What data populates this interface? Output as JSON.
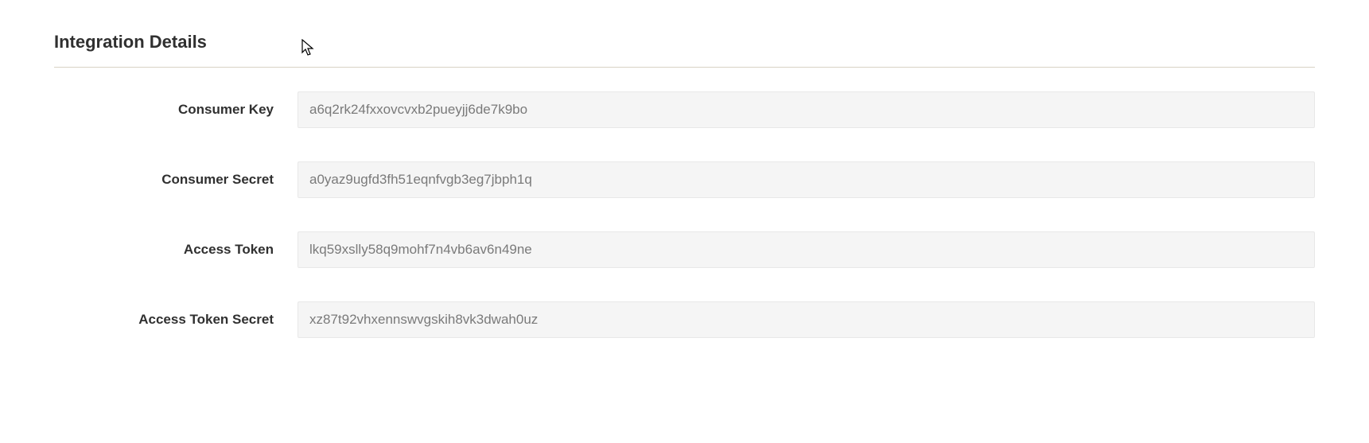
{
  "section": {
    "title": "Integration Details",
    "fields": [
      {
        "label": "Consumer Key",
        "value": "a6q2rk24fxxovcvxb2pueyjj6de7k9bo"
      },
      {
        "label": "Consumer Secret",
        "value": "a0yaz9ugfd3fh51eqnfvgb3eg7jbph1q"
      },
      {
        "label": "Access Token",
        "value": "lkq59xslly58q9mohf7n4vb6av6n49ne"
      },
      {
        "label": "Access Token Secret",
        "value": "xz87t92vhxennswvgskih8vk3dwah0uz"
      }
    ]
  }
}
